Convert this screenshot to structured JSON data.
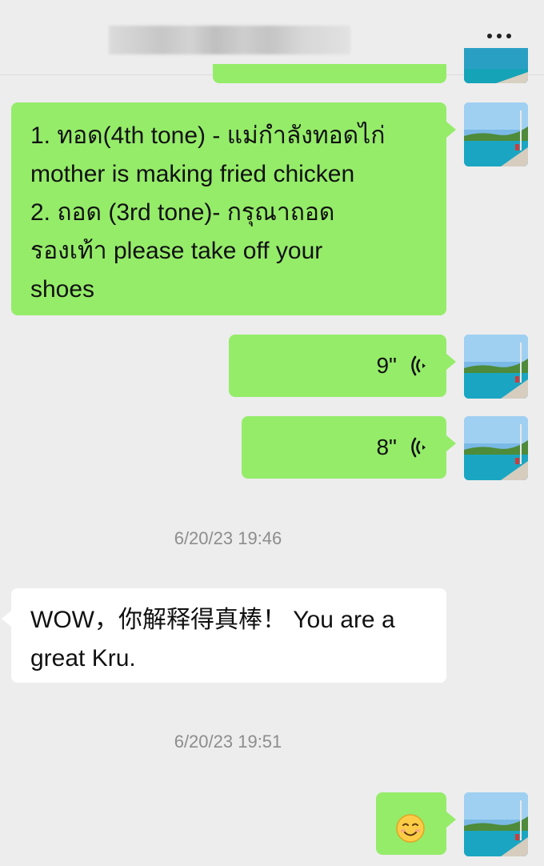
{
  "header": {
    "title_hidden": true,
    "menu_icon": "more-dots-icon"
  },
  "messages": [
    {
      "type": "text",
      "side": "right",
      "text": "1. ทอด(4th tone) - แม่กำลังทอดไก่\nmother is making fried chicken\n2. ถอด (3rd tone)- กรุณาถอด\nรองเท้า please take off your\nshoes"
    },
    {
      "type": "voice",
      "side": "right",
      "duration": "9\"",
      "icon": "voice-wave-icon"
    },
    {
      "type": "voice",
      "side": "right",
      "duration": "8\"",
      "icon": "voice-wave-icon"
    },
    {
      "type": "timestamp",
      "text": "6/20/23 19:46"
    },
    {
      "type": "text",
      "side": "left",
      "text": "WOW，你解释得真棒！ You are a\ngreat Kru."
    },
    {
      "type": "timestamp",
      "text": "6/20/23 19:51"
    },
    {
      "type": "emoji",
      "side": "right",
      "icon": "smile-emoji-icon"
    }
  ],
  "colors": {
    "background": "#ededed",
    "sent_bubble": "#95ec69",
    "received_bubble": "#ffffff",
    "timestamp_text": "#8d8d8d"
  }
}
